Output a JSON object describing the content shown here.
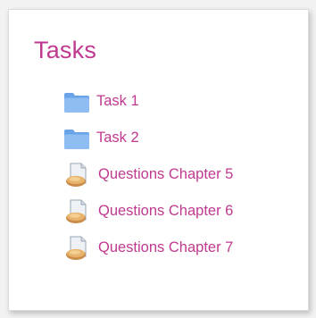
{
  "block": {
    "title": "Tasks",
    "accent_color": "#c0398f",
    "items": [
      {
        "label": "Task 1",
        "icon": "folder-icon"
      },
      {
        "label": "Task 2",
        "icon": "folder-icon"
      },
      {
        "label": "Questions Chapter 5",
        "icon": "quiz-icon"
      },
      {
        "label": "Questions Chapter 6",
        "icon": "quiz-icon"
      },
      {
        "label": "Questions Chapter 7",
        "icon": "quiz-icon"
      }
    ]
  }
}
